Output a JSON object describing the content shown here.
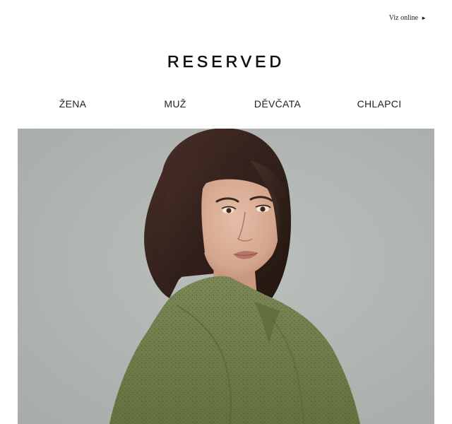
{
  "header": {
    "view_online_label": "Viz online",
    "view_online_arrow": "►"
  },
  "brand": {
    "logo_text": "RESERVED"
  },
  "nav": {
    "items": [
      {
        "label": "ŽENA"
      },
      {
        "label": "MUŽ"
      },
      {
        "label": "DĚVČATA"
      },
      {
        "label": "CHLAPCI"
      }
    ]
  },
  "hero": {
    "icon": "fashion-photo",
    "colors": {
      "background": "#b0b5b2",
      "hair": "#3a2620",
      "skin": "#d9ae98",
      "blouse": "#6d7a4a"
    }
  }
}
